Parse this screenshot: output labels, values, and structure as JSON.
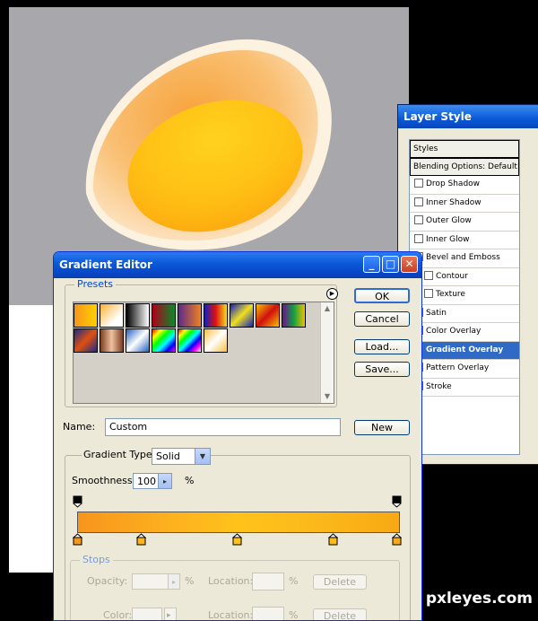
{
  "layer_style": {
    "title": "Layer Style",
    "styles_header": "Styles",
    "items": [
      {
        "label": "Blending Options: Default",
        "checkbox": false,
        "selected": false
      },
      {
        "label": "Drop Shadow",
        "checkbox": true,
        "selected": false
      },
      {
        "label": "Inner Shadow",
        "checkbox": true,
        "selected": false
      },
      {
        "label": "Outer Glow",
        "checkbox": true,
        "selected": false
      },
      {
        "label": "Inner Glow",
        "checkbox": true,
        "selected": false
      },
      {
        "label": "Bevel and Emboss",
        "checkbox": true,
        "selected": false
      },
      {
        "label": "Contour",
        "checkbox": true,
        "selected": false
      },
      {
        "label": "Texture",
        "checkbox": true,
        "selected": false
      },
      {
        "label": "Satin",
        "checkbox": true,
        "selected": false
      },
      {
        "label": "Color Overlay",
        "checkbox": true,
        "selected": false
      },
      {
        "label": "Gradient Overlay",
        "checkbox": true,
        "selected": true
      },
      {
        "label": "Pattern Overlay",
        "checkbox": true,
        "selected": false
      },
      {
        "label": "Stroke",
        "checkbox": true,
        "selected": false
      }
    ]
  },
  "gradient_editor": {
    "title": "Gradient Editor",
    "presets_label": "Presets",
    "buttons": {
      "ok": "OK",
      "cancel": "Cancel",
      "load": "Load...",
      "save": "Save...",
      "new": "New"
    },
    "name_label": "Name:",
    "name_value": "Custom",
    "gradient_type_label": "Gradient Type:",
    "gradient_type_value": "Solid",
    "smoothness_label": "Smoothness:",
    "smoothness_value": "100",
    "percent": "%",
    "gradient_colors": [
      "#f7951d",
      "#fdb21e",
      "#ffc21b",
      "#fcbb1b",
      "#f8a913"
    ],
    "stops": {
      "label": "Stops",
      "opacity_label": "Opacity:",
      "location_label": "Location:",
      "color_label": "Color:",
      "delete_label": "Delete",
      "percent": "%"
    }
  },
  "watermark": "pxleyes.com"
}
